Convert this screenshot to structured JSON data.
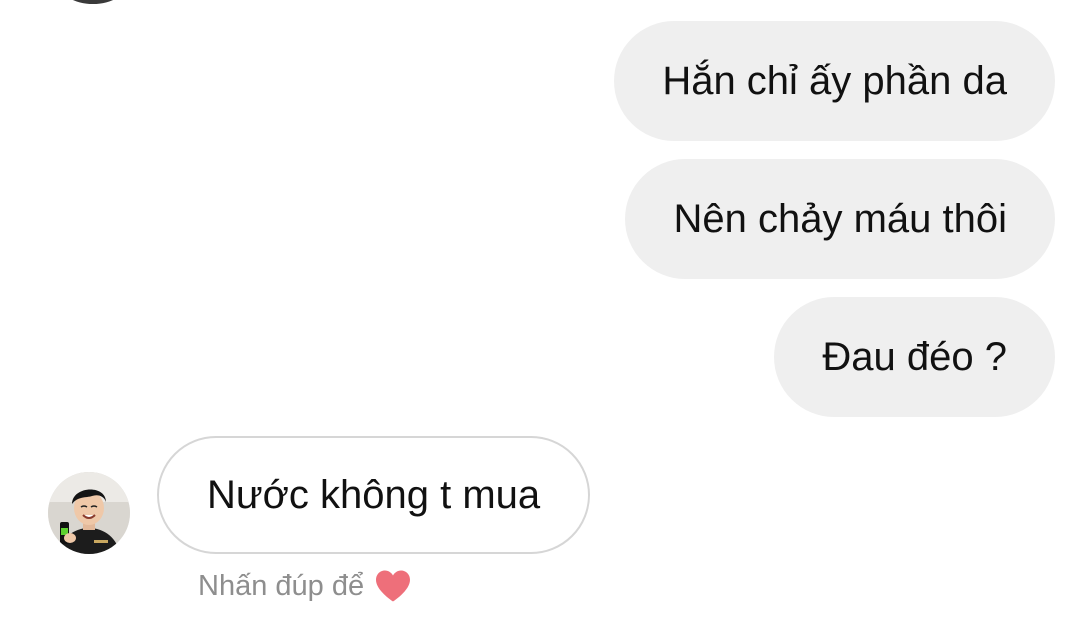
{
  "conversation": {
    "outgoing": [
      {
        "text": "Hắn chỉ ấy phần da"
      },
      {
        "text": "Nên chảy máu thôi"
      },
      {
        "text": "Đau đéo ?"
      }
    ],
    "incoming": {
      "text": "Nước không t mua",
      "avatar_icon": "user-avatar"
    },
    "hint": {
      "label": "Nhấn đúp để",
      "icon": "heart-icon",
      "icon_color": "#ee6f7a"
    }
  },
  "colors": {
    "outgoing_bubble": "#efefef",
    "incoming_border": "#d6d6d6",
    "hint_text": "#8e8e8e"
  }
}
